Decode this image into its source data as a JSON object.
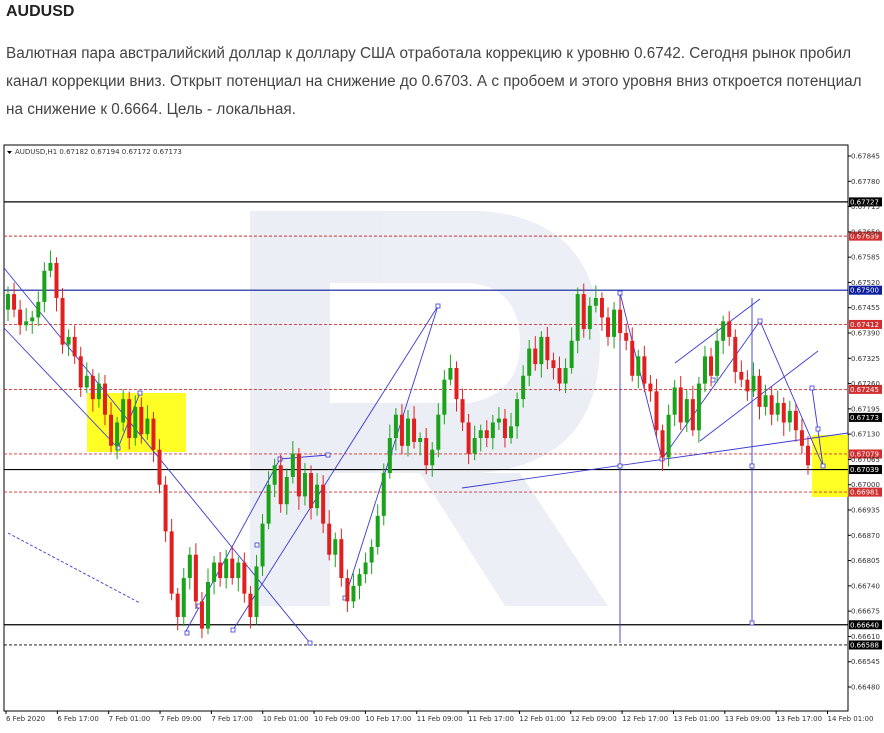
{
  "page": {
    "title": "AUDUSD",
    "description": "Валютная пара австралийский доллар к доллару США отработала коррекцию к уровню 0.6742. Сегодня рынок пробил канал коррекции вниз. Открыт потенциал на снижение до 0.6703. А с пробоем и этого уровня вниз откроется потенциал на снижение к 0.6664. Цель - локальная."
  },
  "chart_data": {
    "type": "candlestick",
    "header": "AUDUSD,H1  0.67182 0.67194 0.67172 0.67173",
    "y_ticks": [
      "0.67845",
      "0.67780",
      "0.67715",
      "0.67650",
      "0.67585",
      "0.67520",
      "0.67455",
      "0.67390",
      "0.67325",
      "0.67260",
      "0.67195",
      "0.67130",
      "0.67065",
      "0.67000",
      "0.66935",
      "0.66870",
      "0.66805",
      "0.66740",
      "0.66675",
      "0.66610",
      "0.66545",
      "0.66480"
    ],
    "x_ticks": [
      "6 Feb 2020",
      "6 Feb 17:00",
      "7 Feb 01:00",
      "7 Feb 09:00",
      "7 Feb 17:00",
      "10 Feb 01:00",
      "10 Feb 09:00",
      "10 Feb 17:00",
      "11 Feb 09:00",
      "11 Feb 17:00",
      "12 Feb 01:00",
      "12 Feb 09:00",
      "12 Feb 17:00",
      "13 Feb 01:00",
      "13 Feb 09:00",
      "13 Feb 17:00",
      "14 Feb 01:00"
    ],
    "ylim": [
      0.6644,
      0.679
    ],
    "levels": [
      {
        "value": "0.67727",
        "style": "solid",
        "color": "#000000"
      },
      {
        "value": "0.67639",
        "style": "dashed",
        "color": "#d32f2f"
      },
      {
        "value": "0.67500",
        "style": "solid",
        "color": "#0d1f9e"
      },
      {
        "value": "0.67412",
        "style": "dashed",
        "color": "#d32f2f"
      },
      {
        "value": "0.67245",
        "style": "dashed",
        "color": "#d32f2f"
      },
      {
        "value": "0.67173",
        "style": "none",
        "color": "#000000"
      },
      {
        "value": "0.67079",
        "style": "dashed",
        "color": "#d32f2f"
      },
      {
        "value": "0.67039",
        "style": "solid",
        "color": "#000000"
      },
      {
        "value": "0.66981",
        "style": "dashed",
        "color": "#d32f2f"
      },
      {
        "value": "0.66640",
        "style": "solid",
        "color": "#000000"
      },
      {
        "value": "0.66588",
        "style": "dashed",
        "color": "#000000"
      }
    ],
    "candles_close": [
      0.6749,
      0.6745,
      0.6741,
      0.6742,
      0.6743,
      0.6747,
      0.6755,
      0.6757,
      0.6748,
      0.6736,
      0.6738,
      0.6733,
      0.6725,
      0.6728,
      0.6722,
      0.6726,
      0.6718,
      0.671,
      0.6716,
      0.6722,
      0.6712,
      0.672,
      0.6713,
      0.6717,
      0.6709,
      0.67,
      0.6688,
      0.6672,
      0.6666,
      0.6676,
      0.6682,
      0.667,
      0.6663,
      0.6675,
      0.668,
      0.6676,
      0.6681,
      0.6676,
      0.668,
      0.6672,
      0.6666,
      0.6679,
      0.669,
      0.67,
      0.6705,
      0.6695,
      0.6702,
      0.6708,
      0.6697,
      0.6703,
      0.6694,
      0.67,
      0.669,
      0.6682,
      0.6686,
      0.6676,
      0.667,
      0.6674,
      0.6677,
      0.668,
      0.6684,
      0.6692,
      0.6703,
      0.6712,
      0.6718,
      0.671,
      0.6717,
      0.6711,
      0.6712,
      0.6705,
      0.6709,
      0.6718,
      0.6727,
      0.673,
      0.6722,
      0.6716,
      0.6708,
      0.6712,
      0.6714,
      0.6712,
      0.6716,
      0.6717,
      0.6712,
      0.6715,
      0.6722,
      0.6728,
      0.6735,
      0.6731,
      0.6738,
      0.6732,
      0.673,
      0.6726,
      0.673,
      0.6737,
      0.6749,
      0.674,
      0.6746,
      0.6748,
      0.6743,
      0.6738,
      0.6745,
      0.6739,
      0.6737,
      0.6728,
      0.6733,
      0.6726,
      0.6724,
      0.6714,
      0.6707,
      0.6718,
      0.6725,
      0.6716,
      0.6722,
      0.6714,
      0.6726,
      0.6733,
      0.6728,
      0.6737,
      0.6742,
      0.6738,
      0.6729,
      0.6727,
      0.6724,
      0.6728,
      0.672,
      0.6723,
      0.6718,
      0.6721,
      0.6716,
      0.6719,
      0.6714,
      0.671,
      0.6705
    ]
  }
}
